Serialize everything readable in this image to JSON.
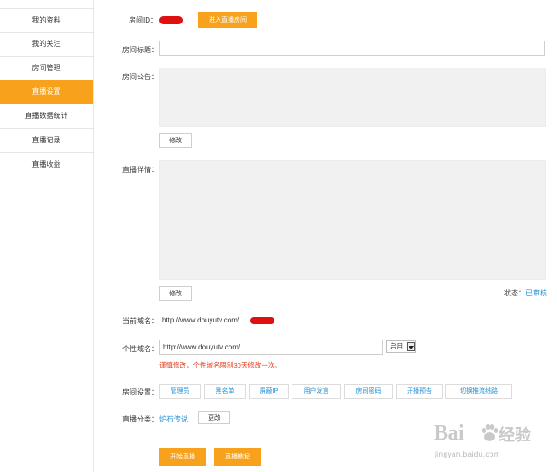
{
  "sidebar": {
    "items": [
      {
        "label": "我的资料"
      },
      {
        "label": "我的关注"
      },
      {
        "label": "房间管理"
      },
      {
        "label": "直播设置",
        "active": true
      },
      {
        "label": "直播数据统计"
      },
      {
        "label": "直播记录"
      },
      {
        "label": "直播收益"
      }
    ]
  },
  "room": {
    "id_label": "房间ID：",
    "enter_button": "进入直播房间",
    "title_label": "房间标题：",
    "title_value": "",
    "notice_label": "房间公告：",
    "notice_edit": "修改",
    "detail_label": "直播详情：",
    "detail_edit": "修改",
    "status_label": "状态：",
    "status_value": "已审核"
  },
  "domain": {
    "current_label": "当前域名：",
    "current_value": "http://www.douyutv.com/",
    "custom_label": "个性域名：",
    "custom_prefix": "http://www.douyutv.com/",
    "custom_value": "",
    "select_value": "启用",
    "warning": "谨慎修改，个性域名限制30天修改一次。"
  },
  "settings": {
    "label": "房间设置：",
    "buttons": [
      "管理员",
      "黑名单",
      "屏蔽IP",
      "用户发言",
      "房间密码",
      "开播预告",
      "切换推流线路"
    ]
  },
  "category": {
    "label": "直播分类：",
    "value": "炉石传说",
    "change_button": "更改"
  },
  "actions": {
    "start": "开始直播",
    "tutorial": "直播教程"
  },
  "watermark": {
    "logo": "Bai",
    "logo_cn": "经验",
    "url": "jingyan.baidu.com"
  },
  "colors": {
    "accent": "#f7a11c",
    "link": "#1e90d6",
    "warning": "#e53b1c",
    "redaction": "#e01010"
  }
}
